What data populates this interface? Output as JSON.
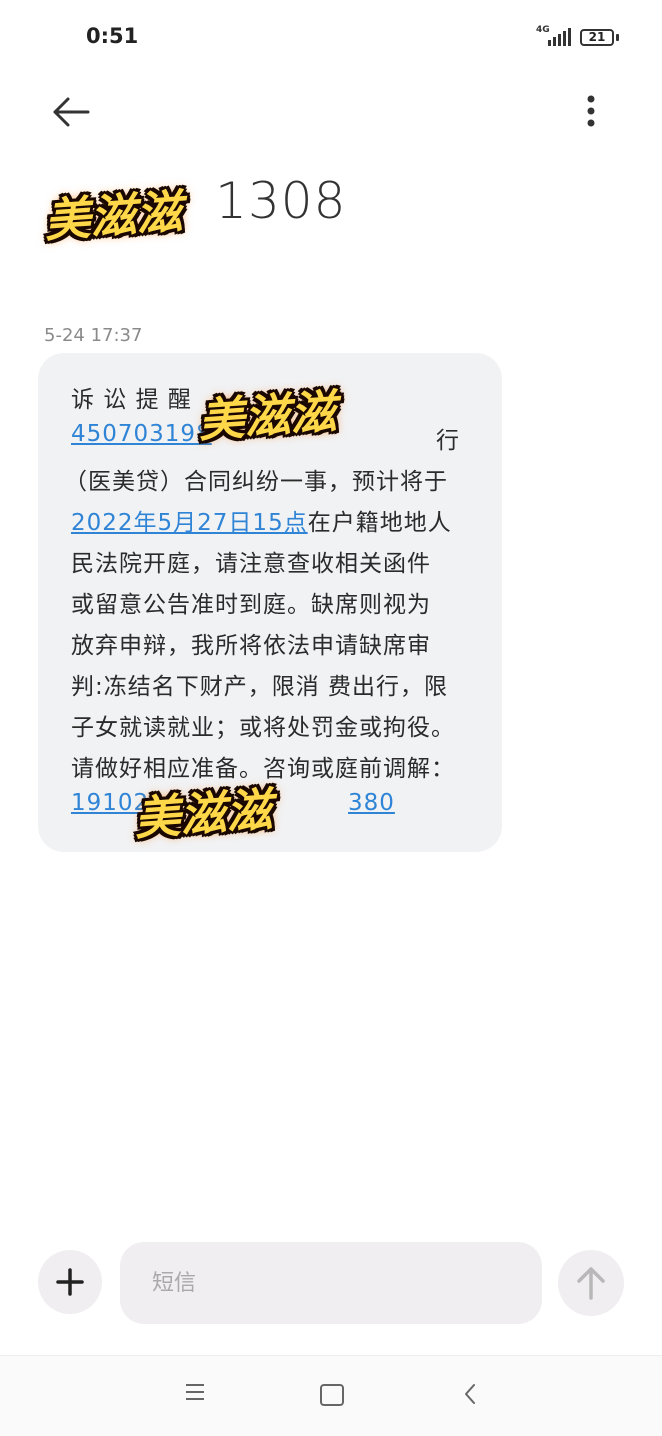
{
  "status_bar": {
    "time": "0:51",
    "network": "4G",
    "battery": "21"
  },
  "header": {
    "contact_number": "1308",
    "contact_subtitle": "",
    "back_icon": "arrow-left-icon",
    "more_icon": "more-vertical-icon"
  },
  "message": {
    "timestamp": "5-24 17:37",
    "lines": [
      "诉 讼 提 醒",
      "行",
      "（医美贷）合同纠纷一事，预计将于",
      "在户籍地地人",
      "民法院开庭，请注意查收相关函件",
      "或留意公告准时到庭。缺席则视为",
      "放弃申辩，我所将依法申请缺席审",
      "判:冻结名下财产，限消 费出行，限",
      "子女就读就业；或将处罚金或拘役。",
      "请做好相应准备。咨询或庭前调解："
    ],
    "link_id": "450703198",
    "link_date": "2022年5月27日15点",
    "link_phone_start": "19102",
    "link_phone_end": "380"
  },
  "watermark": {
    "text": "美滋滋"
  },
  "composer": {
    "placeholder": "短信",
    "add_icon": "plus-icon",
    "send_icon": "arrow-up-icon"
  },
  "nav": {
    "menu_icon": "menu-icon",
    "home_icon": "square-icon",
    "back_icon": "chevron-left-icon"
  },
  "colors": {
    "link": "#2f84d6",
    "bubble": "#f1f2f4",
    "input_bg": "#f1eef2"
  }
}
